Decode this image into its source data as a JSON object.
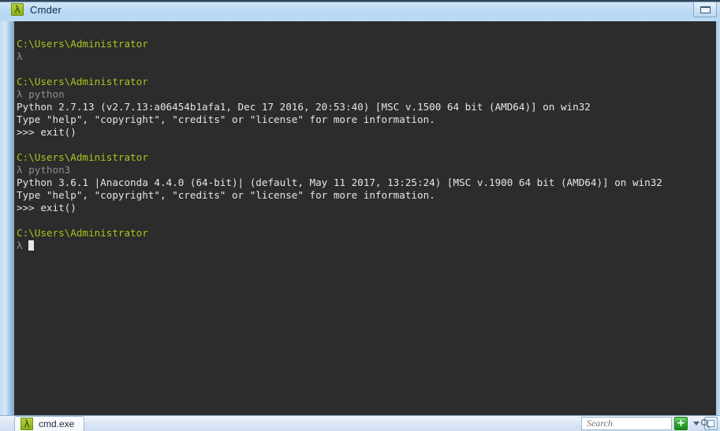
{
  "window": {
    "title": "Cmder",
    "app_icon": "lambda-icon",
    "restore_button_icon": "restore-window-icon"
  },
  "console": {
    "background_color": "#2b2c2b",
    "path_color": "#a6c520",
    "prompt_color": "#8d9089",
    "output_color": "#e6e6e6",
    "cursor": "block-cursor",
    "lines": [
      {
        "type": "blank",
        "text": " "
      },
      {
        "type": "path",
        "text": "C:\\Users\\Administrator"
      },
      {
        "type": "prompt",
        "text": "λ"
      },
      {
        "type": "blank",
        "text": " "
      },
      {
        "type": "path",
        "text": "C:\\Users\\Administrator"
      },
      {
        "type": "prompt",
        "text": "λ python"
      },
      {
        "type": "output",
        "text": "Python 2.7.13 (v2.7.13:a06454b1afa1, Dec 17 2016, 20:53:40) [MSC v.1500 64 bit (AMD64)] on win32"
      },
      {
        "type": "output",
        "text": "Type \"help\", \"copyright\", \"credits\" or \"license\" for more information."
      },
      {
        "type": "output",
        "text": ">>> exit()"
      },
      {
        "type": "blank",
        "text": " "
      },
      {
        "type": "path",
        "text": "C:\\Users\\Administrator"
      },
      {
        "type": "prompt",
        "text": "λ python3"
      },
      {
        "type": "output",
        "text": "Python 3.6.1 |Anaconda 4.4.0 (64-bit)| (default, May 11 2017, 13:25:24) [MSC v.1900 64 bit (AMD64)] on win32"
      },
      {
        "type": "output",
        "text": "Type \"help\", \"copyright\", \"credits\" or \"license\" for more information."
      },
      {
        "type": "output",
        "text": ">>> exit()"
      },
      {
        "type": "blank",
        "text": " "
      },
      {
        "type": "path",
        "text": "C:\\Users\\Administrator"
      },
      {
        "type": "prompt-cursor",
        "text": "λ "
      }
    ]
  },
  "status_bar": {
    "tabs": [
      {
        "label": "cmd.exe",
        "icon": "lambda-icon",
        "active": true
      }
    ],
    "search": {
      "placeholder": "Search",
      "value": "",
      "icon": "search-icon"
    },
    "new_tab_label": "+",
    "new_tab_icon": "plus-icon",
    "new_tab_dropdown_icon": "chevron-down-icon",
    "lock_button_icon": "status-lock-icon"
  }
}
